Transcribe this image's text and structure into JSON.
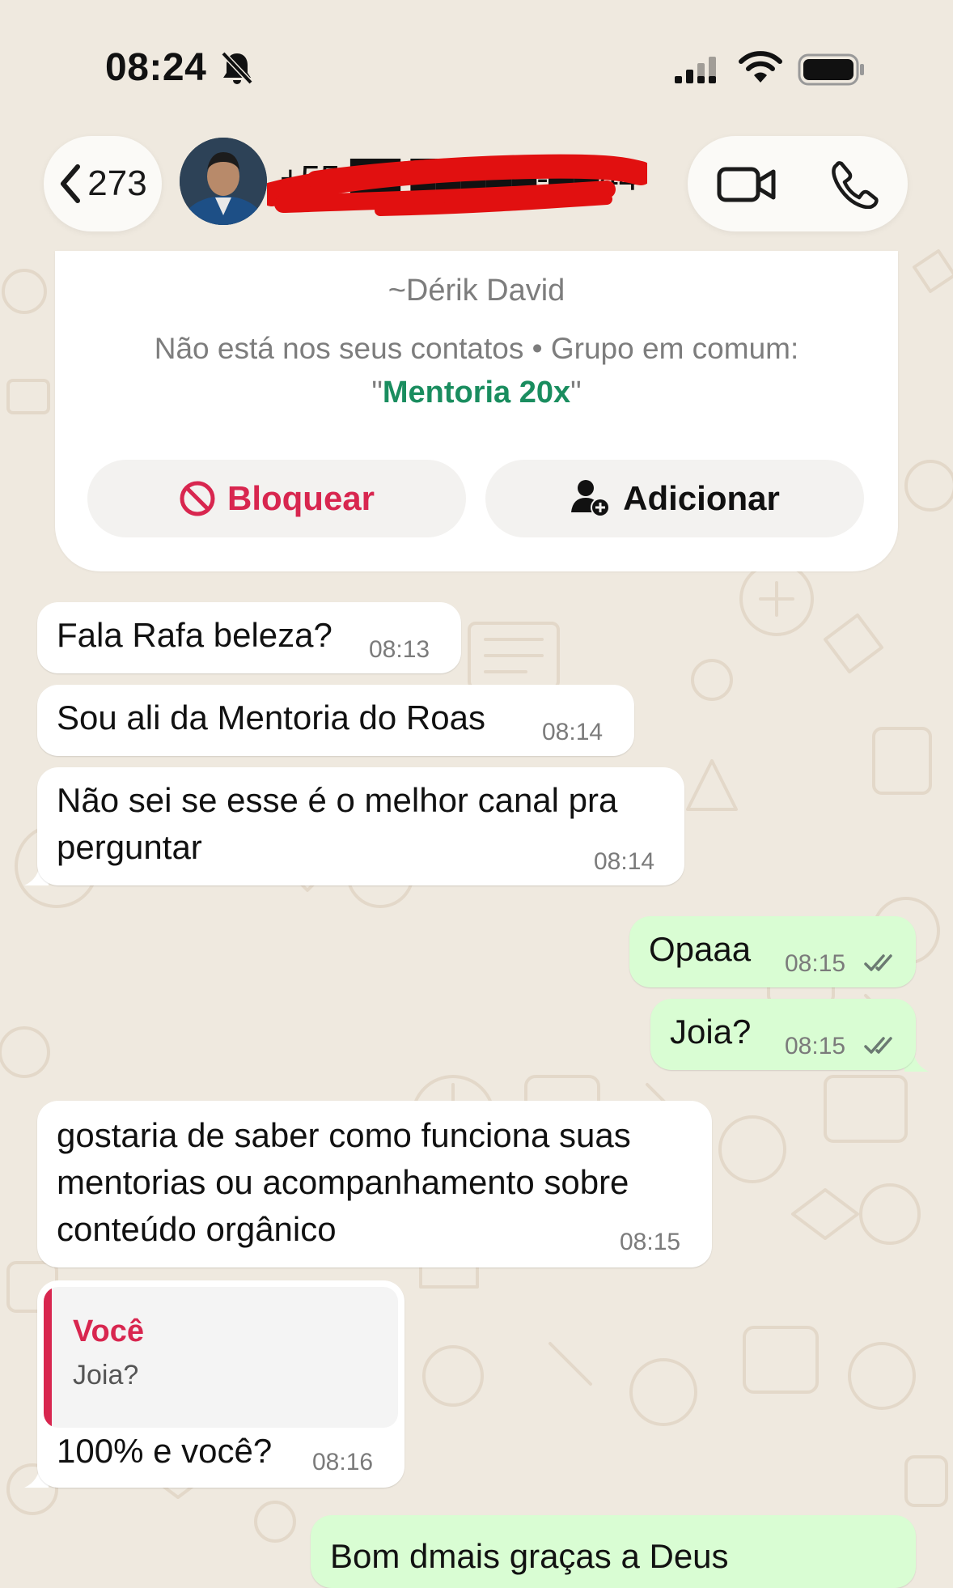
{
  "status_bar": {
    "time": "08:24"
  },
  "header": {
    "back_count": "273",
    "contact_title": "+55 ██ █████-██44"
  },
  "info_card": {
    "name": "~Dérik David",
    "status_text": "Não está nos seus contatos • Grupo em comum:",
    "group_open_quote": "\"",
    "group_name": "Mentoria 20x",
    "group_close_quote": "\"",
    "block_label": "Bloquear",
    "add_label": "Adicionar"
  },
  "messages": [
    {
      "dir": "in",
      "lines": [
        "Fala Rafa beleza?"
      ],
      "time": "08:13"
    },
    {
      "dir": "in",
      "lines": [
        "Sou ali da Mentoria do Roas"
      ],
      "time": "08:14"
    },
    {
      "dir": "in",
      "lines": [
        "Não sei se esse é o melhor canal pra",
        "perguntar"
      ],
      "time": "08:14"
    },
    {
      "dir": "out",
      "lines": [
        "Opaaa"
      ],
      "time": "08:15",
      "status": "read"
    },
    {
      "dir": "out",
      "lines": [
        "Joia?"
      ],
      "time": "08:15",
      "status": "read"
    },
    {
      "dir": "in",
      "lines": [
        "gostaria de saber como funciona suas",
        "mentorias ou acompanhamento sobre",
        "conteúdo orgânico"
      ],
      "time": "08:15"
    },
    {
      "dir": "in",
      "quote_author": "Você",
      "quote_text": "Joia?",
      "lines": [
        "100% e você?"
      ],
      "time": "08:16"
    },
    {
      "dir": "out",
      "lines": [
        "Bom dmais graças a Deus"
      ],
      "time": ""
    }
  ],
  "icons": {
    "back": "chevron-left-icon",
    "video": "video-camera-icon",
    "call": "phone-icon",
    "block": "block-icon",
    "add": "add-contact-icon",
    "read_status": "double-check-icon"
  },
  "colors": {
    "incoming_bubble": "#ffffff",
    "outgoing_bubble": "#d9fdd3",
    "accent_red": "#d8264f",
    "group_green": "#1a8d5f",
    "wallpaper": "#efe9df"
  }
}
